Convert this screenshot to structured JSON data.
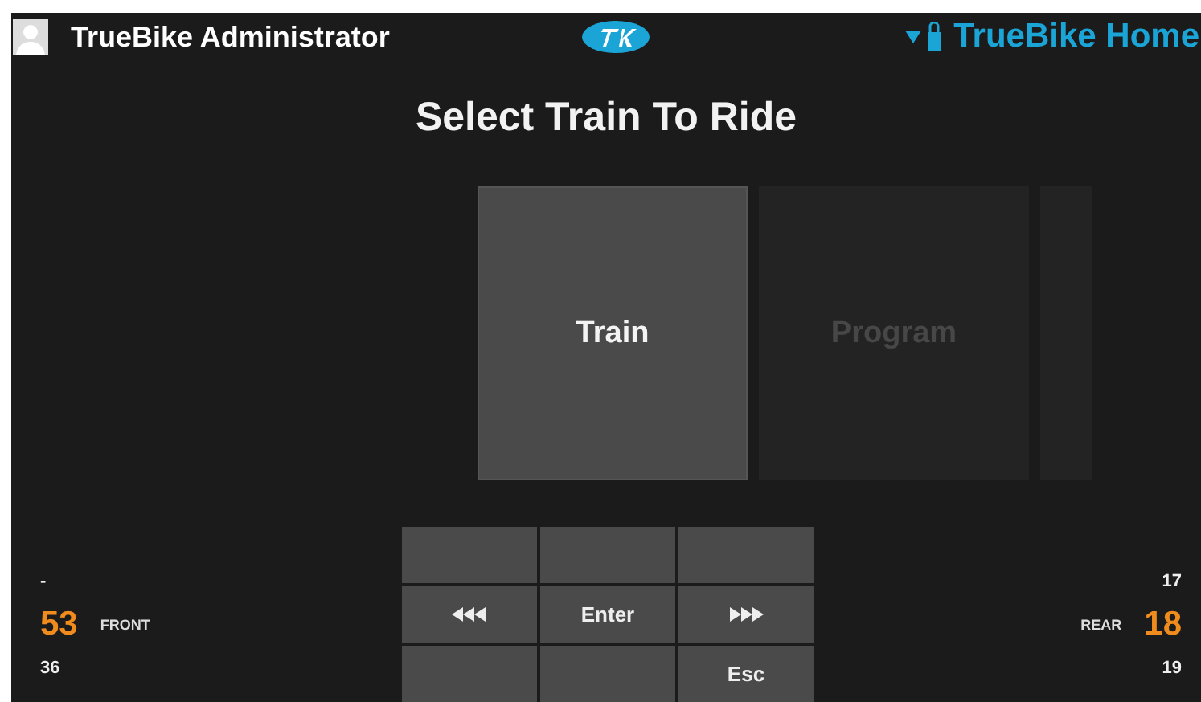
{
  "header": {
    "user": "TrueBike Administrator",
    "location": "TrueBike Home"
  },
  "title": "Select Train To Ride",
  "tiles": [
    {
      "label": "Train",
      "selected": true
    },
    {
      "label": "Program",
      "selected": false
    },
    {
      "selected": false
    }
  ],
  "keypad": [
    {
      "kind": "blank"
    },
    {
      "kind": "blank"
    },
    {
      "kind": "blank"
    },
    {
      "kind": "back"
    },
    {
      "kind": "text",
      "label": "Enter"
    },
    {
      "kind": "forward"
    },
    {
      "kind": "blank"
    },
    {
      "kind": "blank"
    },
    {
      "kind": "text",
      "label": "Esc"
    }
  ],
  "front": {
    "above": "-",
    "current": "53",
    "label": "FRONT",
    "below": "36"
  },
  "rear": {
    "above": "17",
    "current": "18",
    "label": "REAR",
    "below": "19"
  }
}
